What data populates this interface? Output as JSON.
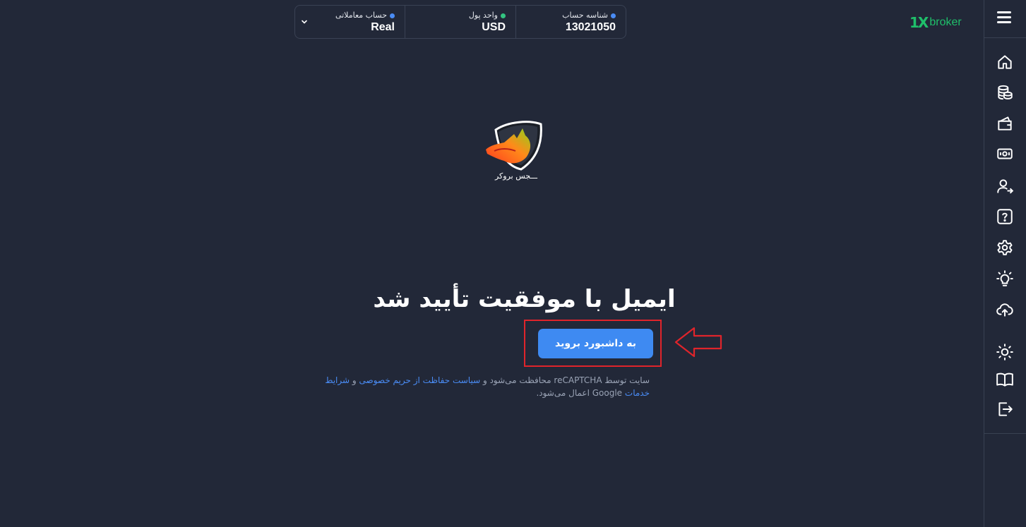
{
  "brand": {
    "mark": "1X",
    "text": "broker",
    "color": "#1fbf6a"
  },
  "account_bar": {
    "account_id": {
      "label": "شناسه حساب",
      "value": "13021050",
      "dot_color": "#4a8cf5"
    },
    "currency": {
      "label": "واحد پول",
      "value": "USD",
      "dot_color": "#33c481"
    },
    "account_type": {
      "label": "حساب معاملاتی",
      "value": "Real",
      "dot_color": "#4a8cf5"
    }
  },
  "logo": {
    "caption": "ـــجس بروکر"
  },
  "main": {
    "heading": "ایمیل با موفقیت تأیید شد",
    "button_label": "به داشبورد بروید"
  },
  "recaptcha": {
    "part1": "سایت توسط reCAPTCHA محافظت می‌شود و ",
    "privacy_link": "سیاست حفاظت از حریم خصوصی",
    "part2": " و ",
    "terms_link": "شرایط خدمات",
    "part3": " Google اعمال می‌شود."
  },
  "sidebar": {
    "icons": [
      "menu-icon",
      "home-icon",
      "coins-icon",
      "wallet-icon",
      "money-icon",
      "user-transfer-icon",
      "help-icon",
      "settings-icon",
      "lightbulb-icon",
      "upload-cloud-icon",
      "sun-icon",
      "book-icon",
      "logout-icon"
    ]
  },
  "colors": {
    "background": "#222838",
    "accent": "#3e8af2",
    "annotation_red": "#e0242b"
  }
}
